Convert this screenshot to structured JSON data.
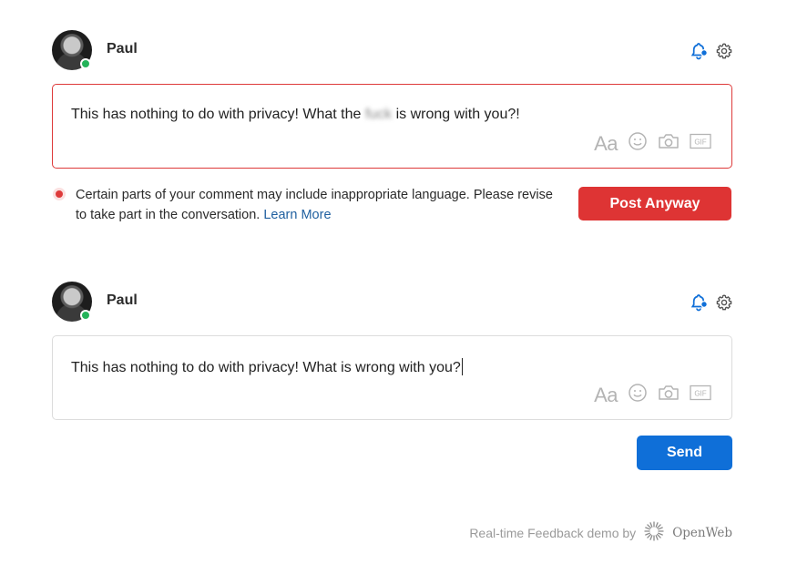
{
  "comment_blocks": [
    {
      "user": {
        "name": "Paul",
        "online": true
      },
      "input": {
        "text_before": "This has nothing to do with privacy! What the ",
        "text_blurred": "fuck",
        "text_after": " is wrong with you?!",
        "state": "error"
      },
      "warning": {
        "message": "Certain parts of your comment may include inappropriate language. Please revise to take part in the conversation.",
        "link_label": "Learn More"
      },
      "submit_label": "Post Anyway"
    },
    {
      "user": {
        "name": "Paul",
        "online": true
      },
      "input": {
        "text": "This has nothing to do with privacy! What is wrong with you?",
        "state": "normal"
      },
      "submit_label": "Send"
    }
  ],
  "toolbar": {
    "format_label": "Aa",
    "icons": [
      "text-format-icon",
      "emoji-icon",
      "camera-icon",
      "gif-icon"
    ],
    "gif_label": "GIF"
  },
  "header_icons": [
    "notification-bell-icon",
    "settings-gear-icon"
  ],
  "footer": {
    "caption": "Real-time Feedback demo by",
    "brand": "OpenWeb"
  },
  "colors": {
    "error": "#de3434",
    "primary": "#0f6fd8",
    "online": "#24b35a",
    "link": "#1f5f9f"
  }
}
